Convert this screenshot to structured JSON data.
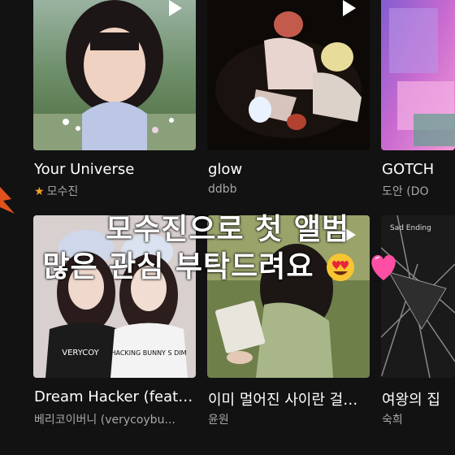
{
  "albums": [
    {
      "title": "Your Universe",
      "artist": "모수진",
      "featured_star": true
    },
    {
      "title": "glow",
      "artist": "ddbb"
    },
    {
      "title": "GOTCH",
      "artist": "도안 (DO"
    },
    {
      "title": "Dream Hacker (feat....",
      "artist": "베리코이버니 (verycoybu..."
    },
    {
      "title": "이미 멀어진 사이란 걸…",
      "artist": "윤원"
    },
    {
      "title": "여왕의 집",
      "artist": "숙희"
    }
  ],
  "album_art_text": {
    "sad_ending": "Sad Ending",
    "shirt_left": "VERYCOY",
    "shirt_right": "HACKING BUNNY S DIM"
  },
  "overlay_caption": {
    "line1": "모수진으로 첫 앨범",
    "line2": "많은 관심 부탁드려요"
  },
  "colors": {
    "background": "#121212",
    "secondary_text": "#a7a7a7",
    "star": "#f5a623"
  }
}
